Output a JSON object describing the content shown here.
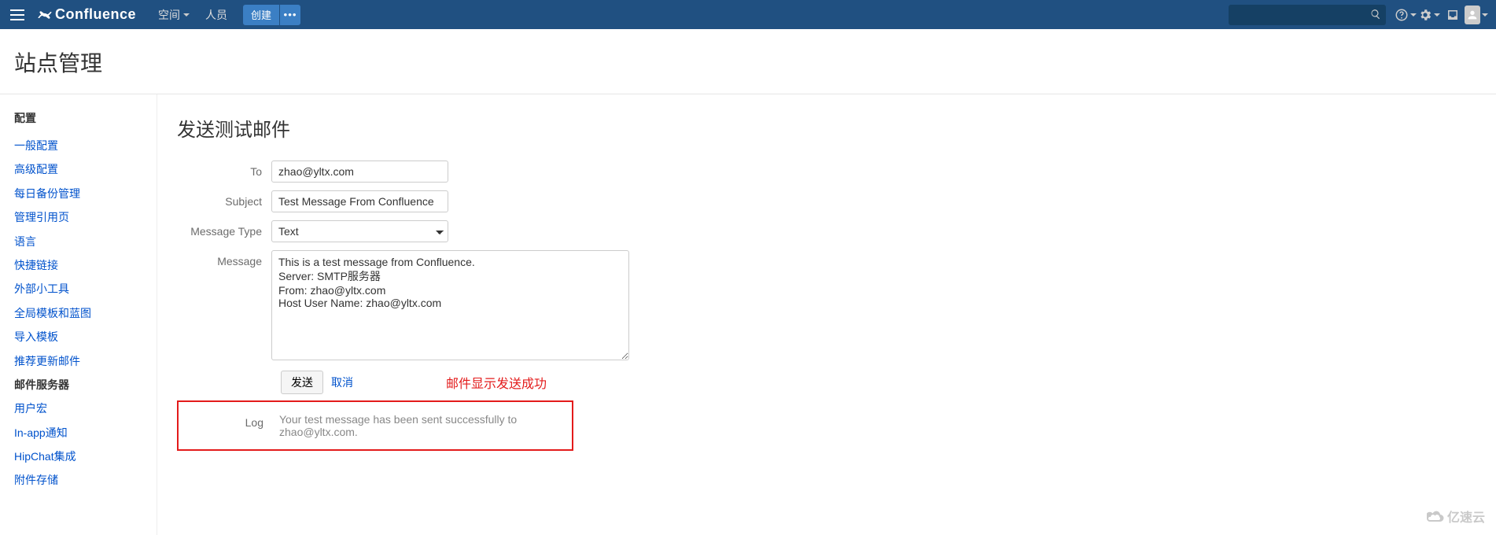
{
  "topnav": {
    "logo_text": "Confluence",
    "spaces_label": "空间",
    "people_label": "人员",
    "create_label": "创建",
    "more_label": "•••",
    "search_placeholder": ""
  },
  "page_title": "站点管理",
  "sidebar": {
    "heading": "配置",
    "items": [
      {
        "label": "一般配置",
        "active": false
      },
      {
        "label": "高级配置",
        "active": false
      },
      {
        "label": "每日备份管理",
        "active": false
      },
      {
        "label": "管理引用页",
        "active": false
      },
      {
        "label": "语言",
        "active": false
      },
      {
        "label": "快捷链接",
        "active": false
      },
      {
        "label": "外部小工具",
        "active": false
      },
      {
        "label": "全局模板和蓝图",
        "active": false
      },
      {
        "label": "导入模板",
        "active": false
      },
      {
        "label": "推荐更新邮件",
        "active": false
      },
      {
        "label": "邮件服务器",
        "active": true
      },
      {
        "label": "用户宏",
        "active": false
      },
      {
        "label": "In-app通知",
        "active": false
      },
      {
        "label": "HipChat集成",
        "active": false
      },
      {
        "label": "附件存储",
        "active": false
      }
    ]
  },
  "main": {
    "heading": "发送测试邮件",
    "form": {
      "to_label": "To",
      "to_value": "zhao@yltx.com",
      "subject_label": "Subject",
      "subject_value": "Test Message From Confluence",
      "msgtype_label": "Message Type",
      "msgtype_value": "Text",
      "message_label": "Message",
      "message_value": "This is a test message from Confluence.\nServer: SMTP服务器\nFrom: zhao@yltx.com\nHost User Name: zhao@yltx.com",
      "submit_label": "发送",
      "cancel_label": "取消",
      "success_annotation": "邮件显示发送成功",
      "log_label": "Log",
      "log_value": "Your test message has been sent successfully to zhao@yltx.com."
    }
  },
  "watermark": "亿速云"
}
